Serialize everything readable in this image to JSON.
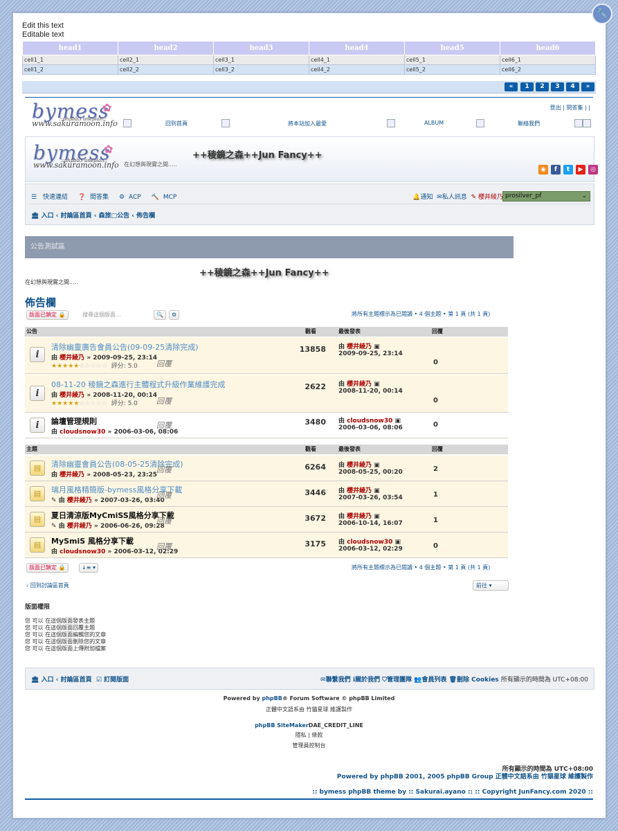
{
  "editor": {
    "line1": "Edit this text",
    "line2": "Editable text"
  },
  "grid": {
    "headers": [
      "head1",
      "head2",
      "head3",
      "head4",
      "head5",
      "head6"
    ],
    "rows": [
      [
        "cell1_1",
        "cell2_1",
        "cell3_1",
        "cell4_1",
        "cell5_1",
        "cell6_1"
      ],
      [
        "cell1_2",
        "cell2_2",
        "cell3_2",
        "cell4_2",
        "cell5_2",
        "cell6_2"
      ]
    ]
  },
  "pager_top": {
    "prev": "«",
    "p1": "1",
    "p2": "2",
    "p3": "3",
    "p4": "4",
    "next": "»"
  },
  "header": {
    "logo_text": "bymess",
    "logo_tag": "::phpbb3 uneplan::",
    "logo_site": "www.sakuramoon.info",
    "top_links": "登出 | 問答集 | |",
    "nav": {
      "home": "回到首頁",
      "favorite": "將本站加入最愛",
      "album": "ALBUM",
      "contact": "聯絡我們"
    },
    "banner_title": "++稜鏡之森++Jun Fancy++",
    "banner_sub": "在幻想與現實之間....."
  },
  "navbar": {
    "quick": "快速連結",
    "faq": "問答集",
    "acp": "ACP",
    "mcp": "MCP",
    "notify": "通知",
    "pm": "私人訊息",
    "user": "櫻井綾乃",
    "style": "prosilver_pf",
    "crumb_portal": "入口",
    "crumb_index": "討論區首頁",
    "crumb_cat": "森旅□公告",
    "crumb_forum": "佈告欄"
  },
  "announcement": {
    "bar": "公告測試區",
    "title": "++稜鏡之森++Jun Fancy++",
    "sub": "在幻想與現實之間....."
  },
  "forum": {
    "title": "佈告欄",
    "locked": "版面已鎖定",
    "search_placeholder": "搜尋這個版面...",
    "mark_read": "將所有主題標示為已閱讀 • 4 個主題 • 第 1 頁 (共 1 頁)",
    "col_ann": "公告",
    "col_topics": "主題",
    "col_views": "觀看",
    "col_last": "最後發表",
    "col_replies": "回覆"
  },
  "announcements": [
    {
      "title": "清除幽靈廣告會員公告(09-09-25清除完成)",
      "by": "由",
      "user": "櫻井綾乃",
      "date": "» 2009-09-25, 23:14",
      "stars": "★★★★★",
      "empty": "☆☆☆☆☆",
      "score": "評分: 5.0",
      "ghost": "回覆",
      "views": "13858",
      "lp_user": "櫻井綾乃",
      "lp_date": "2009-09-25, 23:14",
      "replies": "0"
    },
    {
      "title": "08-11-20 稜鏡之森進行主體程式升級作業維護完成",
      "by": "由",
      "user": "櫻井綾乃",
      "date": "» 2008-11-20, 00:14",
      "stars": "★★★★★",
      "empty": "☆☆☆☆☆",
      "score": "評分: 5.0",
      "ghost": "回覆",
      "views": "2622",
      "lp_user": "櫻井綾乃",
      "lp_date": "2008-11-20, 00:14",
      "replies": "0"
    },
    {
      "title": "論壇管理規則",
      "by": "由",
      "user": "cloudsnow30",
      "date": "» 2006-03-06, 08:06",
      "ghost": "回覆",
      "views": "3480",
      "lp_user": "cloudsnow30",
      "lp_date": "2006-03-06, 08:06",
      "replies": "0"
    }
  ],
  "topics": [
    {
      "title": "清除幽靈會員公告(08-05-25清除完成)",
      "by": "由",
      "user": "櫻井綾乃",
      "date": "» 2008-05-23, 23:25",
      "ghost": "回覆",
      "views": "6264",
      "lp_user": "櫻井綾乃",
      "lp_date": "2008-05-25, 00:20",
      "replies": "2"
    },
    {
      "title": "璃月風格精簡版-bymess風格分享下載",
      "by": "由",
      "user": "櫻井綾乃",
      "date": "» 2007-03-26, 03:40",
      "ghost": "回覆",
      "views": "3446",
      "lp_user": "櫻井綾乃",
      "lp_date": "2007-03-26, 03:54",
      "replies": "1"
    },
    {
      "title": "夏日清涼版MyCmiSS風格分享下載",
      "by": "由",
      "user": "櫻井綾乃",
      "date": "» 2006-06-26, 09:28",
      "ghost": "回覆",
      "views": "3672",
      "lp_user": "櫻井綾乃",
      "lp_date": "2006-10-14, 16:07",
      "replies": "1"
    },
    {
      "title": "MySmiS 風格分享下載",
      "by": "由",
      "user": "cloudsnow30",
      "date": "» 2006-03-12, 02:29",
      "ghost": "回覆",
      "views": "3175",
      "lp_user": "cloudsnow30",
      "lp_date": "2006-03-12, 02:29",
      "replies": "0"
    }
  ],
  "bottom": {
    "back": "回到討論區首頁",
    "jump": "前往",
    "perm_title": "版面權限",
    "perm": [
      "您 可以 在這個版面發表主題",
      "您 可以 在這個版面回覆主題",
      "您 可以 在這個版面編輯您的文章",
      "您 可以 在這個版面刪除您的文章",
      "您 可以 在這個版面上傳附加檔案"
    ]
  },
  "footer": {
    "portal": "入口",
    "index": "討論區首頁",
    "subscribe": "訂閱版面",
    "contact": "聯繫我們",
    "about": "關於我們",
    "team": "管理團隊",
    "members": "會員列表",
    "delete": "刪除 Cookies",
    "tz": "所有顯示的時間為 UTC+08:00",
    "powered_pre": "Powered by",
    "phpbb": "phpBB",
    "powered_post": "® Forum Software © phpBB Limited",
    "trans": "正體中文語系由 竹貓星球 維護製作",
    "sm": "phpBB SiteMaker",
    "sm_credit": "DAE_CREDIT_LINE",
    "privacy": "隱私 | 條款",
    "acp": "管理員控制台",
    "tz2": "所有顯示的時間為 UTC+08:00",
    "powered2": "Powered by phpBB 2001, 2005 phpBB Group 正體中文語系由 竹貓星球 維護製作",
    "theme": ":: bymess phpBB theme by :: Sakurai.ayano :: :: Copyright JunFancy.com 2020 ::"
  }
}
